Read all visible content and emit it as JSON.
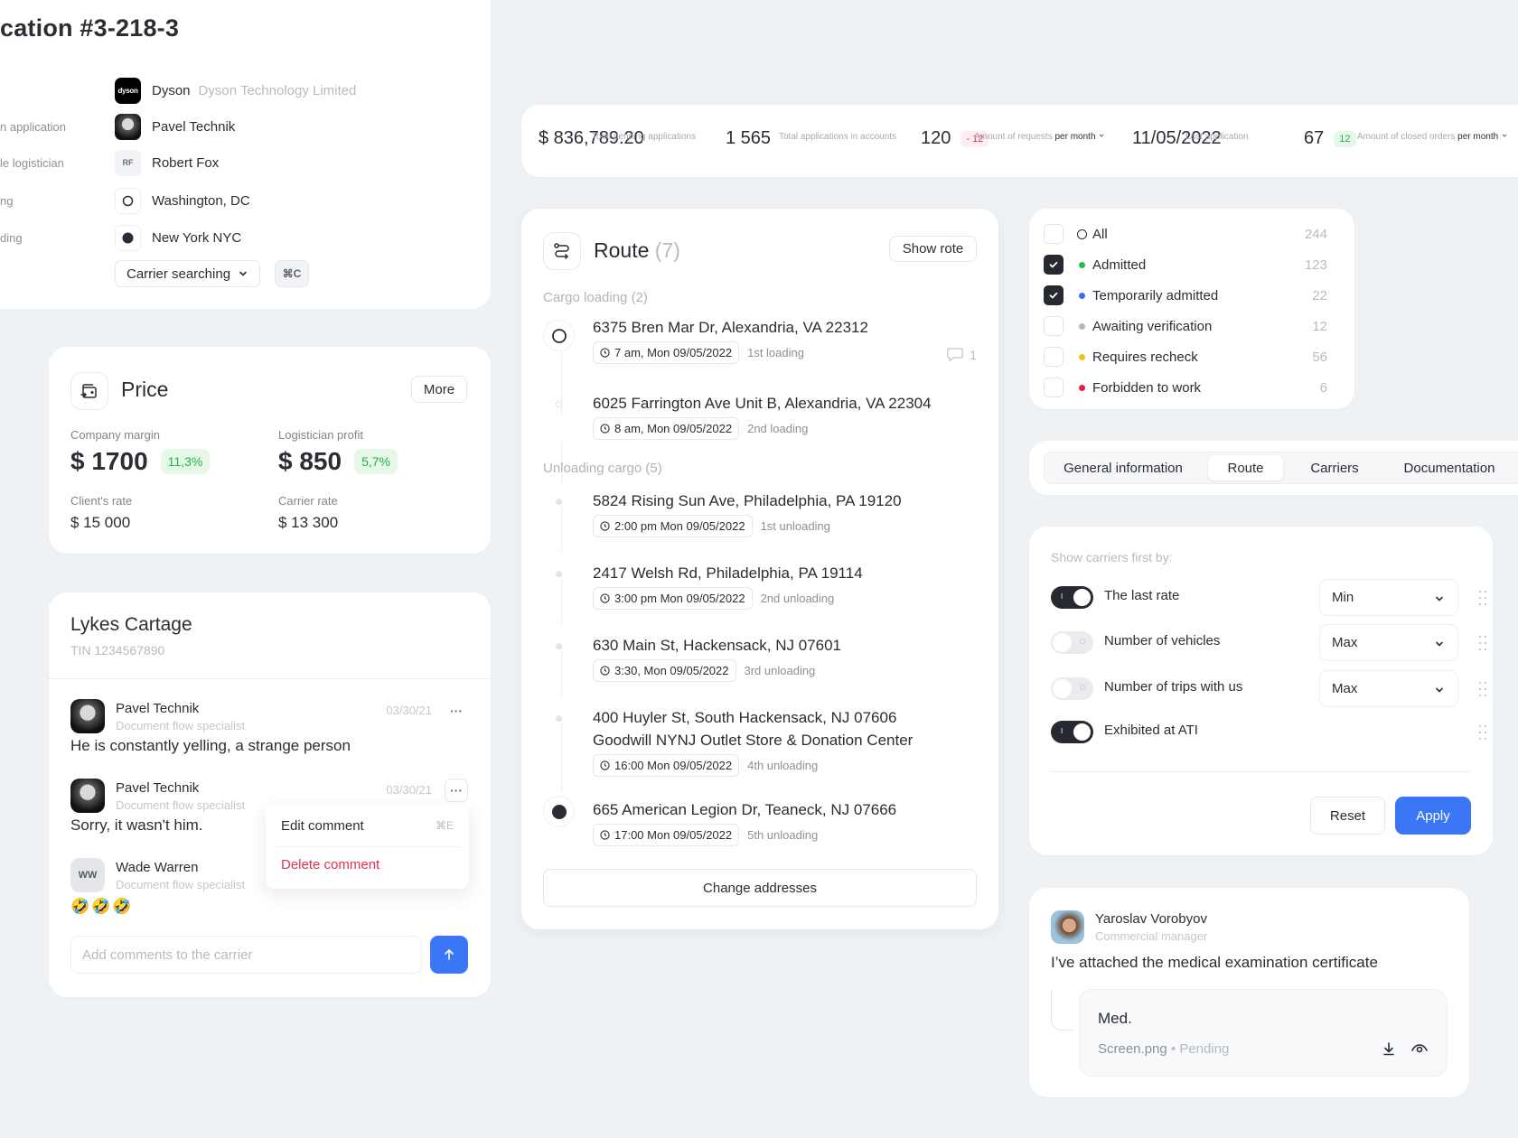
{
  "application": {
    "title": "cation #3-218-3",
    "rows": [
      {
        "label": "",
        "value": "Dyson",
        "sub": "Dyson Technology Limited",
        "avatar": "dyson-logo",
        "avatar_text": "dyson"
      },
      {
        "label": "n application",
        "value": "Pavel Technik",
        "sub": "",
        "avatar": "photo"
      },
      {
        "label": "le logistician",
        "value": "Robert Fox",
        "sub": "",
        "avatar": "initials",
        "avatar_text": "RF"
      },
      {
        "label": "ng",
        "value": "Washington, DC",
        "sub": "",
        "avatar": "ring-icon"
      },
      {
        "label": "ding",
        "value": "New York NYC",
        "sub": "",
        "avatar": "filled-dot-icon"
      }
    ],
    "status_select": "Carrier searching",
    "shortcut": "⌘C"
  },
  "stats": [
    {
      "label": "Total pending applications",
      "label_em": "",
      "value": "$ 836,789.20",
      "delta": "",
      "delta_type": ""
    },
    {
      "label": "Total applications in accounts",
      "label_em": "",
      "value": "1 565",
      "delta": "",
      "delta_type": ""
    },
    {
      "label": "Amount of requests",
      "label_em": "per month",
      "value": "120",
      "delta": "- 12",
      "delta_type": "neg"
    },
    {
      "label": "Last application",
      "label_em": "",
      "value": "11/05/2022",
      "delta": "",
      "delta_type": ""
    },
    {
      "label": "Amount of closed orders",
      "label_em": "per month",
      "value": "67",
      "delta": "12",
      "delta_type": "pos"
    }
  ],
  "price": {
    "title": "Price",
    "more_label": "More",
    "company_margin_label": "Company margin",
    "company_margin": "$ 1700",
    "company_margin_pct": "11,3%",
    "logistician_profit_label": "Logistician profit",
    "logistician_profit": "$ 850",
    "logistician_profit_pct": "5,7%",
    "client_rate_label": "Client's rate",
    "client_rate": "$ 15 000",
    "carrier_rate_label": "Carrier rate",
    "carrier_rate": "$ 13 300"
  },
  "carrier": {
    "name": "Lykes Cartage",
    "tin": "TIN 1234567890",
    "comments": [
      {
        "author": "Pavel Technik",
        "role": "Document flow specialist",
        "date": "03/30/21",
        "text": "He is constantly yelling, a strange person"
      },
      {
        "author": "Pavel Technik",
        "role": "Document flow specialist",
        "date": "03/30/21",
        "text": "Sorry, it wasn't him."
      },
      {
        "author": "Wade Warren",
        "initials": "WW",
        "role": "Document flow specialist",
        "date": "",
        "text": "🤣🤣🤣"
      }
    ],
    "menu": {
      "edit_label": "Edit comment",
      "edit_shortcut": "⌘E",
      "delete_label": "Delete comment"
    },
    "input_placeholder": "Add comments to the carrier",
    "input_value": ""
  },
  "route": {
    "title": "Route",
    "count": "(7)",
    "show_label": "Show rote",
    "loading_header": "Cargo loading (2)",
    "unloading_header": "Unloading cargo (5)",
    "comment_count": "1",
    "stops": [
      {
        "address": "6375 Bren Mar Dr, Alexandria, VA 22312",
        "address2": "",
        "time": "7 am,  Mon 09/05/2022",
        "kind": "1st loading"
      },
      {
        "address": "6025 Farrington Ave Unit B, Alexandria, VA 22304",
        "address2": "",
        "time": "8 am,  Mon 09/05/2022",
        "kind": "2nd loading"
      },
      {
        "address": "5824 Rising Sun Ave, Philadelphia, PA 19120",
        "address2": "",
        "time": "2:00 pm  Mon 09/05/2022",
        "kind": "1st unloading"
      },
      {
        "address": "2417 Welsh Rd, Philadelphia, PA 19114",
        "address2": "",
        "time": "3:00 pm  Mon 09/05/2022",
        "kind": "2nd unloading"
      },
      {
        "address": "630 Main St, Hackensack, NJ 07601",
        "address2": "",
        "time": "3:30, Mon 09/05/2022",
        "kind": "3rd unloading"
      },
      {
        "address": "400 Huyler St, South Hackensack, NJ 07606",
        "address2": "Goodwill NYNJ Outlet Store & Donation Center",
        "time": "16:00  Mon 09/05/2022",
        "kind": "4th unloading"
      },
      {
        "address": "665 American Legion Dr, Teaneck, NJ 07666",
        "address2": "",
        "time": "17:00  Mon 09/05/2022",
        "kind": "5th unloading"
      }
    ],
    "change_label": "Change addresses"
  },
  "filters": [
    {
      "label": "All",
      "count": "244",
      "checked": false,
      "color": "ring"
    },
    {
      "label": "Admitted",
      "count": "123",
      "checked": true,
      "color": "#1fc14a"
    },
    {
      "label": "Temporarily admitted",
      "count": "22",
      "checked": true,
      "color": "#3b6ef6"
    },
    {
      "label": "Awaiting verification",
      "count": "12",
      "checked": false,
      "color": "#b4b8be"
    },
    {
      "label": "Requires recheck",
      "count": "56",
      "checked": false,
      "color": "#f3c417"
    },
    {
      "label": "Forbidden to work",
      "count": "6",
      "checked": false,
      "color": "#e4203f"
    }
  ],
  "tabs": [
    {
      "label": "General information",
      "active": false
    },
    {
      "label": "Route",
      "active": true
    },
    {
      "label": "Carriers",
      "active": false
    },
    {
      "label": "Documentation",
      "active": false
    }
  ],
  "sort": {
    "header": "Show carriers first by:",
    "rows": [
      {
        "label": "The last rate",
        "on": true,
        "select": "Min"
      },
      {
        "label": "Number of vehicles",
        "on": false,
        "select": "Max"
      },
      {
        "label": "Number of trips with us",
        "on": false,
        "select": "Max"
      },
      {
        "label": "Exhibited at ATI",
        "on": true,
        "select": ""
      }
    ],
    "reset_label": "Reset",
    "apply_label": "Apply"
  },
  "attachment": {
    "author": "Yaroslav Vorobyov",
    "role": "Commercial manager",
    "text": "I’ve attached the medical examination certificate",
    "file_title": "Med.",
    "file_name": "Screen.png",
    "file_status": "Pending"
  },
  "colors": {
    "accent": "#3b76f6",
    "positive": "#20b447",
    "negative": "#e0334f",
    "dark": "#26292f"
  }
}
